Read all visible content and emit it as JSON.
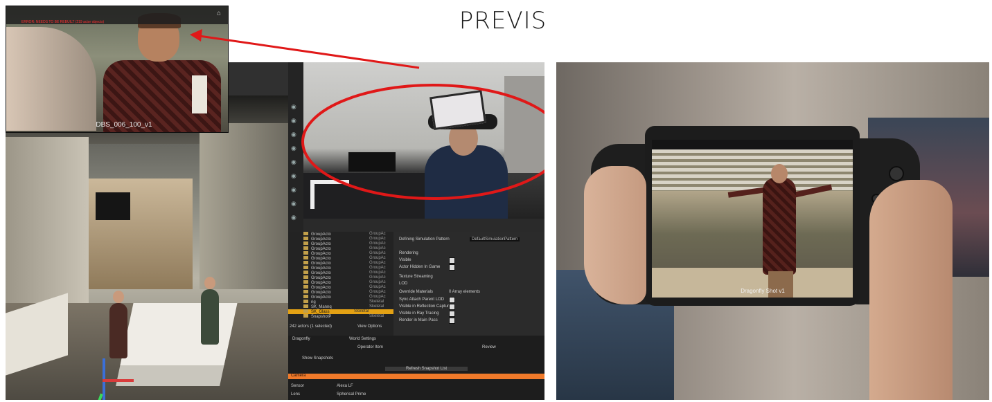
{
  "page": {
    "title": "PREVIS"
  },
  "inset": {
    "caption": "DBS_006_100_v1",
    "warning": "ERROR: NEEDS TO BE REBUILT (219 actor objects)"
  },
  "editor": {
    "outliner_rows": [
      {
        "label": "GroupActo",
        "type": "GroupAc"
      },
      {
        "label": "GroupActo",
        "type": "GroupAc"
      },
      {
        "label": "GroupActo",
        "type": "GroupAc"
      },
      {
        "label": "GroupActo",
        "type": "GroupAc"
      },
      {
        "label": "GroupActo",
        "type": "GroupAc"
      },
      {
        "label": "GroupActo",
        "type": "GroupAc"
      },
      {
        "label": "GroupActo",
        "type": "GroupAc"
      },
      {
        "label": "GroupActo",
        "type": "GroupAc"
      },
      {
        "label": "GroupActo",
        "type": "GroupAc"
      },
      {
        "label": "GroupActo",
        "type": "GroupAc"
      },
      {
        "label": "GroupActo",
        "type": "GroupAc"
      },
      {
        "label": "GroupActo",
        "type": "GroupAc"
      },
      {
        "label": "GroupActo",
        "type": "GroupAc"
      },
      {
        "label": "GroupActo",
        "type": "GroupAc"
      },
      {
        "label": "rig",
        "type": "Skeletal"
      },
      {
        "label": "SK_Mannq",
        "type": "Skeletal"
      },
      {
        "label": "SK_Glass",
        "type": "Skeletal",
        "selected": true
      },
      {
        "label": "SnapshotP",
        "type": "Skeletal"
      }
    ],
    "outliner_footer": "242 actors (1 selected)",
    "view_options": "View Options",
    "details": {
      "simulation_label": "Defining Simulation Pattern",
      "simulation_value": "DefaultSimulationPattern",
      "section_rendering": "Rendering",
      "visible": "Visible",
      "actor_hidden": "Actor Hidden In Game",
      "section_streaming": "Texture Streaming",
      "section_lod": "LOD",
      "override_materials": "Override Materials",
      "override_value": "0 Array elements",
      "sync_attach": "Sync Attach Parent LOD",
      "visible_reflection": "Visible in Reflection Captures",
      "visible_ray": "Visible in Ray Tracing",
      "render_main": "Render in Main Pass"
    },
    "bottom": {
      "tab_dragonfly": "Dragonfly",
      "tab_world": "World Settings",
      "col_operator": "Operator Item",
      "col_review": "Review",
      "show_snapshots": "Show Snapshots",
      "refresh": "Refresh Snapshot List",
      "orange_label": "Camera",
      "sensor_label": "Sensor",
      "sensor_value": "Alexa LF",
      "lens_label": "Lens",
      "lens_value": "Spherical Prime"
    }
  },
  "photo": {
    "caption": "Dragonfly Shot v1"
  },
  "colors": {
    "annotation": "#e01818",
    "selection": "#e3a114",
    "accent_orange": "#f07a2a"
  }
}
